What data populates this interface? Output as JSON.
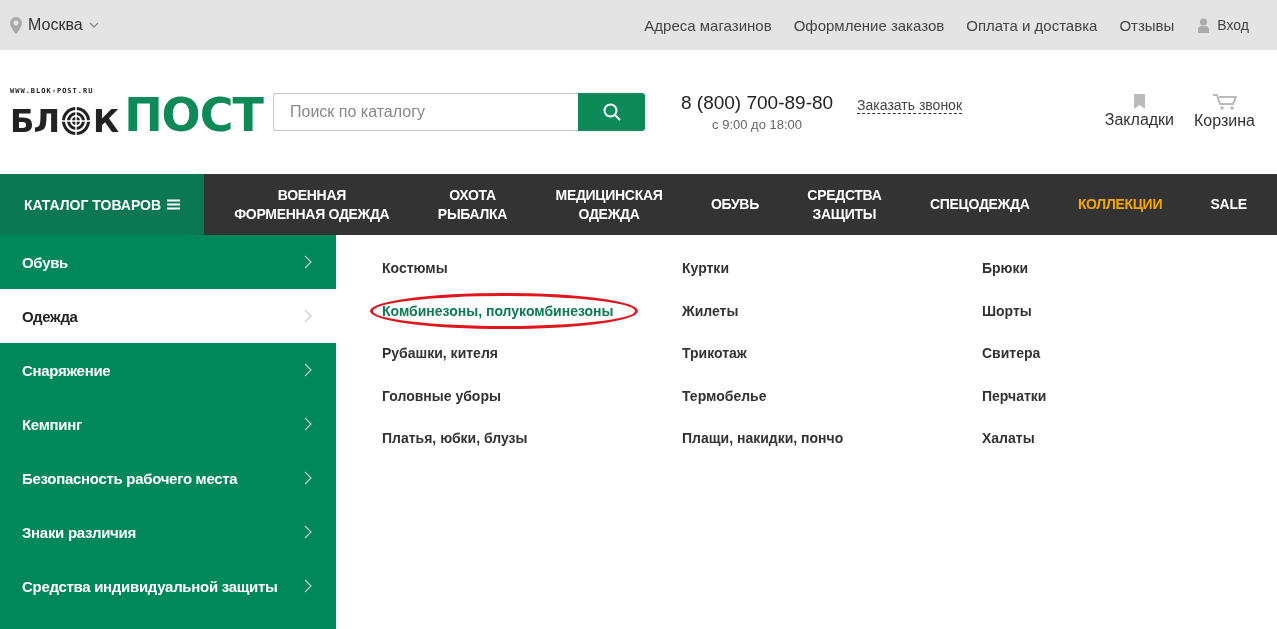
{
  "top_bar": {
    "city": "Москва",
    "links": [
      "Адреса магазинов",
      "Оформление заказов",
      "Оплата и доставка",
      "Отзывы"
    ],
    "login": "Вход"
  },
  "header": {
    "logo": {
      "url": "WWW.BLOK-POST.RU",
      "left": "БЛ",
      "middle": "К",
      "right": "ПОСТ"
    },
    "search": {
      "placeholder": "Поиск по каталогу"
    },
    "phone": "8 (800) 700-89-80",
    "hours": "с 9:00 до 18:00",
    "callback": "Заказать звонок",
    "bookmarks": "Закладки",
    "cart": "Корзина"
  },
  "nav": {
    "catalog": "КАТАЛОГ ТОВАРОВ",
    "items": [
      {
        "label": "ВОЕННАЯ\nФОРМЕННАЯ ОДЕЖДА",
        "kind": "normal"
      },
      {
        "label": "ОХОТА\nРЫБАЛКА",
        "kind": "normal"
      },
      {
        "label": "МЕДИЦИНСКАЯ\nОДЕЖДА",
        "kind": "normal"
      },
      {
        "label": "ОБУВЬ",
        "kind": "normal"
      },
      {
        "label": "СРЕДСТВА\nЗАЩИТЫ",
        "kind": "normal"
      },
      {
        "label": "СПЕЦОДЕЖДА",
        "kind": "normal"
      },
      {
        "label": "КОЛЛЕКЦИИ",
        "kind": "accent"
      },
      {
        "label": "SALE",
        "kind": "normal"
      }
    ]
  },
  "sidebar": {
    "items": [
      {
        "label": "Обувь",
        "selected": false
      },
      {
        "label": "Одежда",
        "selected": true
      },
      {
        "label": "Снаряжение",
        "selected": false
      },
      {
        "label": "Кемпинг",
        "selected": false
      },
      {
        "label": "Безопасность рабочего места",
        "selected": false
      },
      {
        "label": "Знаки различия",
        "selected": false
      },
      {
        "label": "Средства индивидуальной защиты",
        "selected": false
      }
    ]
  },
  "submenu": {
    "columns": [
      [
        {
          "label": "Костюмы",
          "highlighted": false
        },
        {
          "label": "Комбинезоны, полукомбинезоны",
          "highlighted": true
        },
        {
          "label": "Рубашки, кителя",
          "highlighted": false
        },
        {
          "label": "Головные уборы",
          "highlighted": false
        },
        {
          "label": "Платья, юбки, блузы",
          "highlighted": false
        }
      ],
      [
        {
          "label": "Куртки",
          "highlighted": false
        },
        {
          "label": "Жилеты",
          "highlighted": false
        },
        {
          "label": "Трикотаж",
          "highlighted": false
        },
        {
          "label": "Термобелье",
          "highlighted": false
        },
        {
          "label": "Плащи, накидки, пончо",
          "highlighted": false
        }
      ],
      [
        {
          "label": "Брюки",
          "highlighted": false
        },
        {
          "label": "Шорты",
          "highlighted": false
        },
        {
          "label": "Свитера",
          "highlighted": false
        },
        {
          "label": "Перчатки",
          "highlighted": false
        },
        {
          "label": "Халаты",
          "highlighted": false
        }
      ]
    ]
  }
}
